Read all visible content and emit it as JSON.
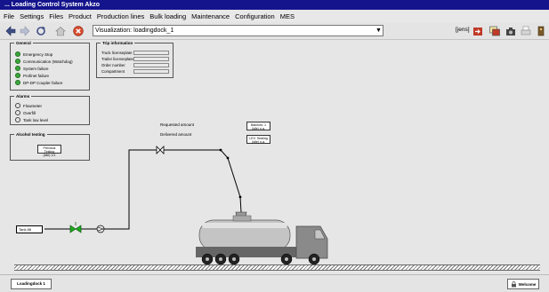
{
  "window": {
    "title": "... Loading Control System Akzo"
  },
  "menu": {
    "items": [
      "File",
      "Settings",
      "Files",
      "Product",
      "Production lines",
      "Bulk loading",
      "Maintenance",
      "Configuration",
      "MES"
    ]
  },
  "toolbar": {
    "visualization_value": "Visualization: loadingdock_1",
    "user_label": "[jens]",
    "icons": [
      "back-arrow-icon",
      "forward-arrow-icon",
      "refresh-icon",
      "home-icon",
      "stop-icon",
      "export-icon",
      "window-icon",
      "camera-icon",
      "printer-icon",
      "exit-icon"
    ]
  },
  "general": {
    "title": "General",
    "items": [
      {
        "label": "Emergency Stop",
        "state": "ok"
      },
      {
        "label": "Communication (Watchdog)",
        "state": "ok"
      },
      {
        "label": "System failure",
        "state": "ok"
      },
      {
        "label": "Profinet failure",
        "state": "ok"
      },
      {
        "label": "DP-DP Coupler failure",
        "state": "ok"
      }
    ]
  },
  "trip": {
    "title": "Trip information",
    "fields": [
      {
        "label": "Truck licenseplate",
        "value": ""
      },
      {
        "label": "Trailer licenseplate",
        "value": ""
      },
      {
        "label": "Order number",
        "value": ""
      },
      {
        "label": "Compartment",
        "value": ""
      }
    ]
  },
  "alarms": {
    "title": "Alarms",
    "items": [
      {
        "label": "Flowmeter",
        "state": "off"
      },
      {
        "label": "Overfill",
        "state": "off"
      },
      {
        "label": "Tank low level",
        "state": "off"
      }
    ]
  },
  "alcohol": {
    "title": "Alcohol testing",
    "box_line1": "Previous Testing",
    "box_line2": "(idle) 1/1"
  },
  "process": {
    "requested_label": "Requested amount",
    "delivered_label": "Delivered amount",
    "box_a_line1": "Batches: 1",
    "box_a_line2": "(idle) n.a.",
    "box_b_line1": "LEV. Sealing",
    "box_b_line2": "(idle) n.a.",
    "source_label": "Tank 88",
    "colors": {
      "pipe": "#000000",
      "valve_open": "#1faa1f",
      "tank": "#c4c4c4",
      "cab": "#8a8a8a"
    }
  },
  "statusbar": {
    "dock_tab": "Loadingdock 1",
    "welcome": "Welcome"
  }
}
